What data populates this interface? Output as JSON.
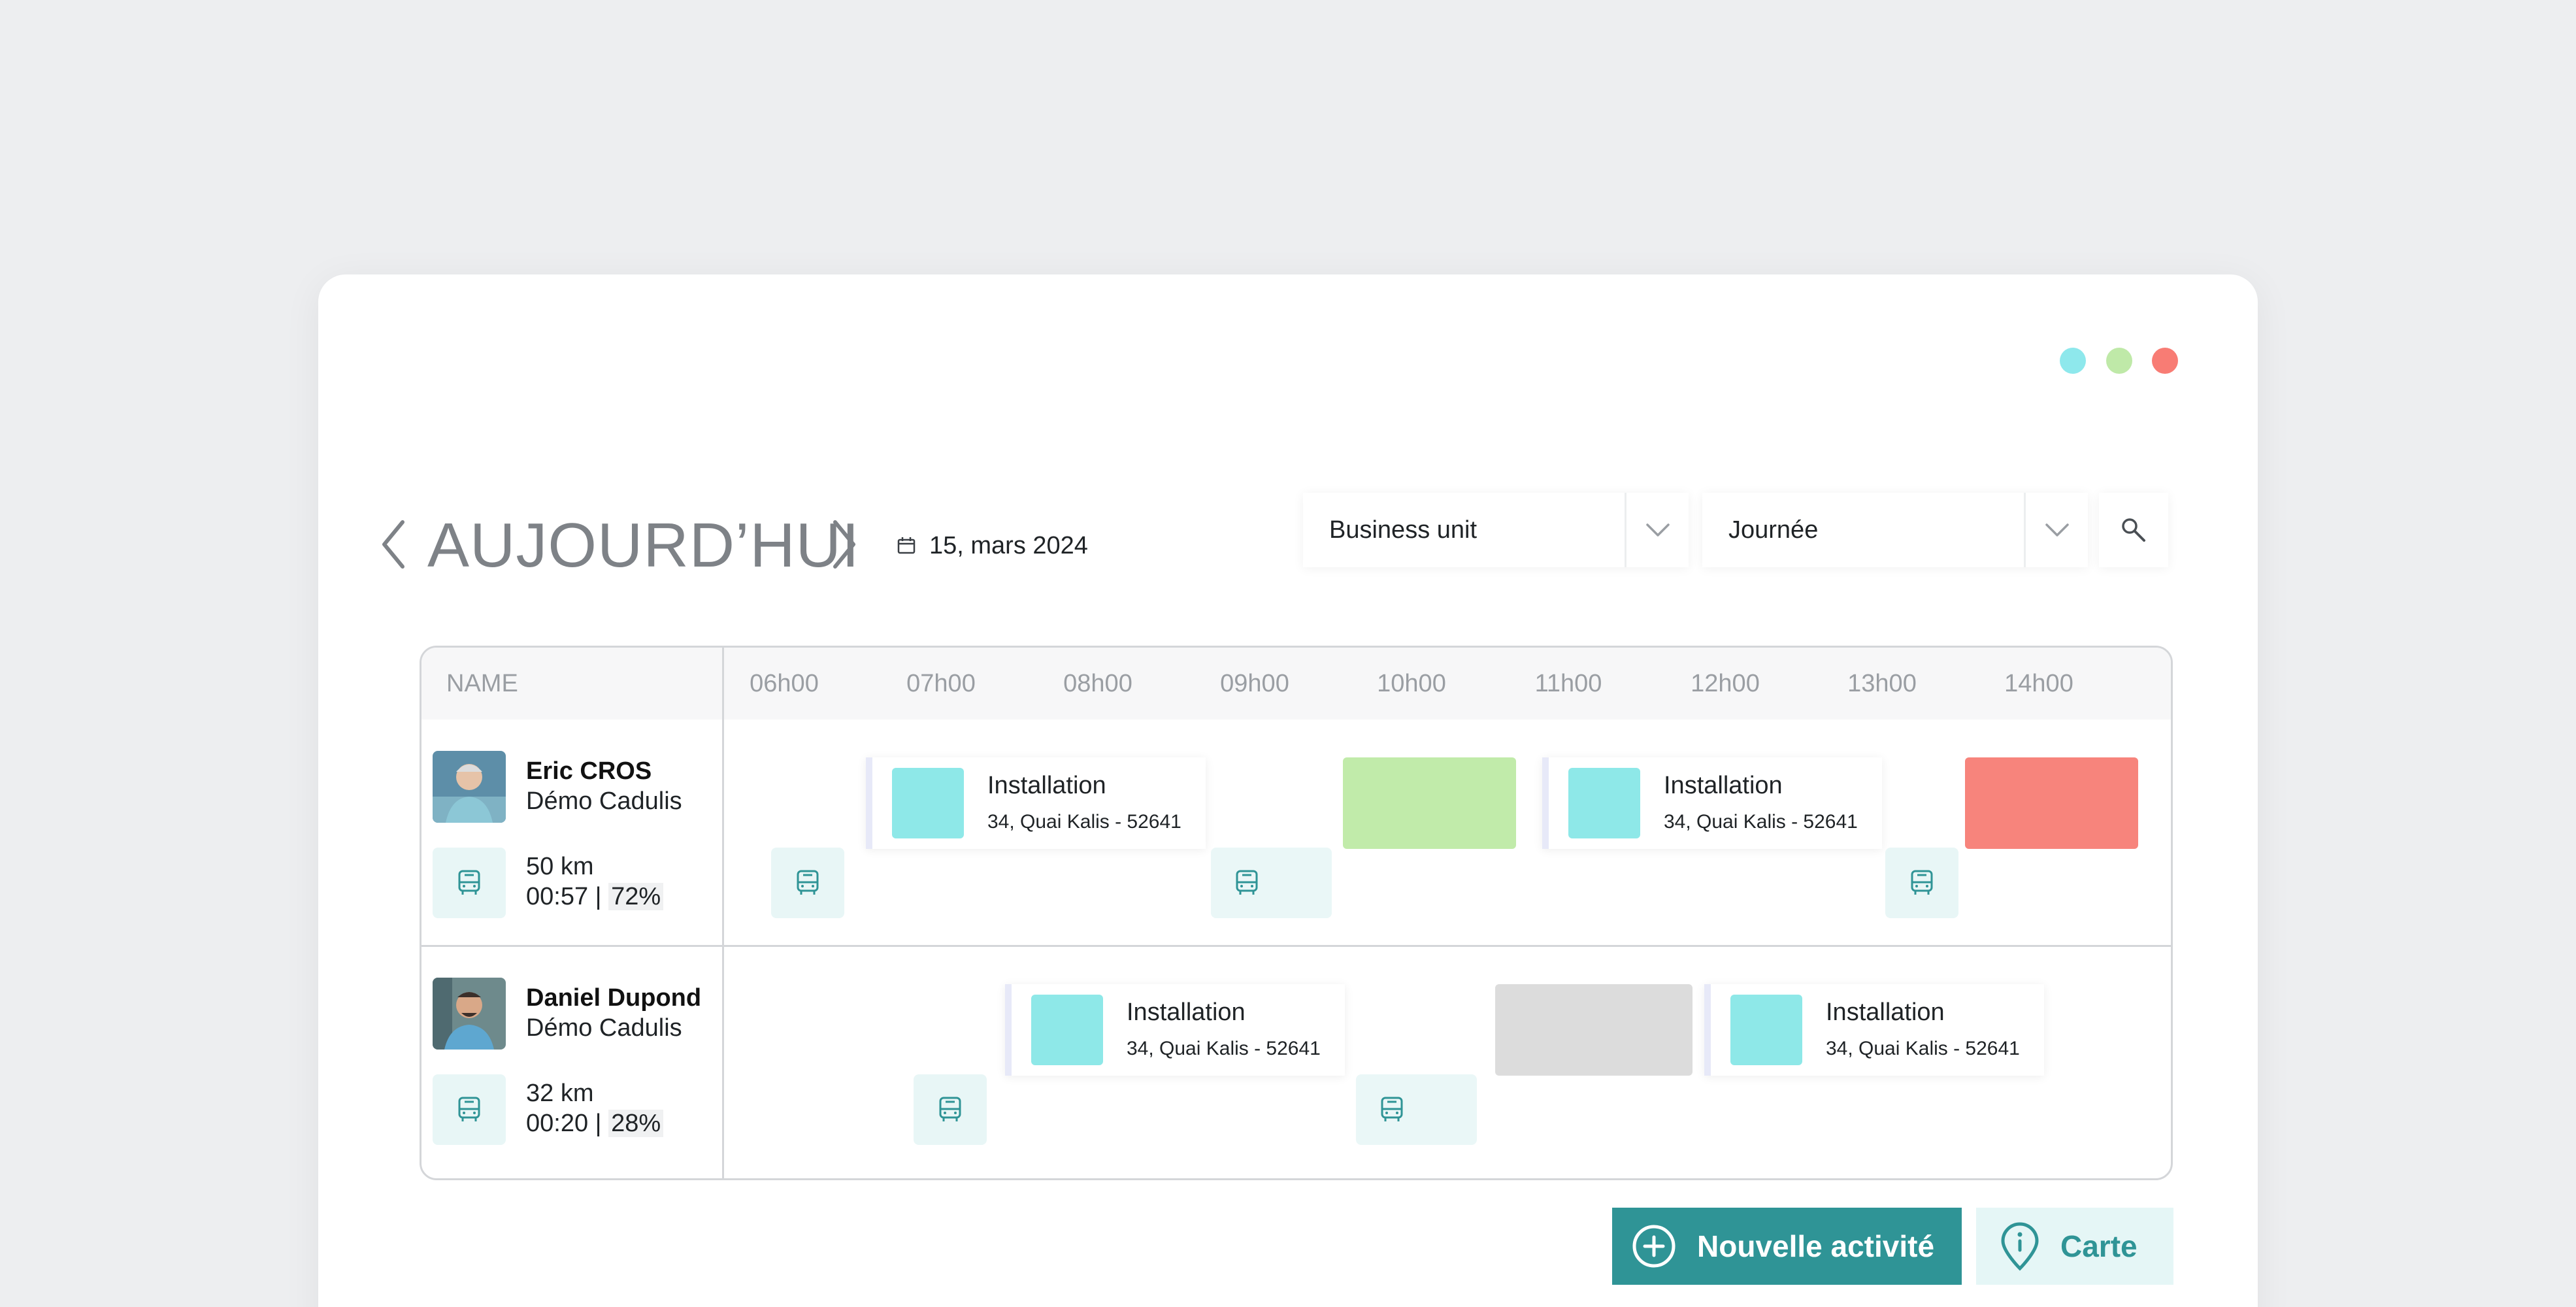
{
  "window": {
    "dot_colors": [
      "#8ee8ec",
      "#bfe9a8",
      "#f87c74"
    ]
  },
  "header": {
    "title": "AUJOURD’HUI",
    "date": "15, mars 2024",
    "business_unit": "Business unit",
    "view": "Journée"
  },
  "table": {
    "name_header": "NAME",
    "hours": [
      "06h00",
      "07h00",
      "08h00",
      "09h00",
      "10h00",
      "11h00",
      "12h00",
      "13h00",
      "14h00"
    ]
  },
  "people": [
    {
      "name": "Eric CROS",
      "org": "Démo Cadulis",
      "distance": "50 km",
      "time": "00:57",
      "separator": " | ",
      "ratio": "72%"
    },
    {
      "name": "Daniel Dupond",
      "org": "Démo Cadulis",
      "distance": "32 km",
      "time": "00:20",
      "separator": " | ",
      "ratio": "28%"
    }
  ],
  "activity": {
    "title": "Installation",
    "address": "34, Quai Kalis - 52641"
  },
  "colors": {
    "accent": "#2f9496",
    "teal_light": "#8ee8e8",
    "green_block": "#c1ebaa",
    "red_block": "#f7847c",
    "grey_block": "#dcdcdc"
  },
  "actions": {
    "new_activity": "Nouvelle activité",
    "map": "Carte"
  }
}
